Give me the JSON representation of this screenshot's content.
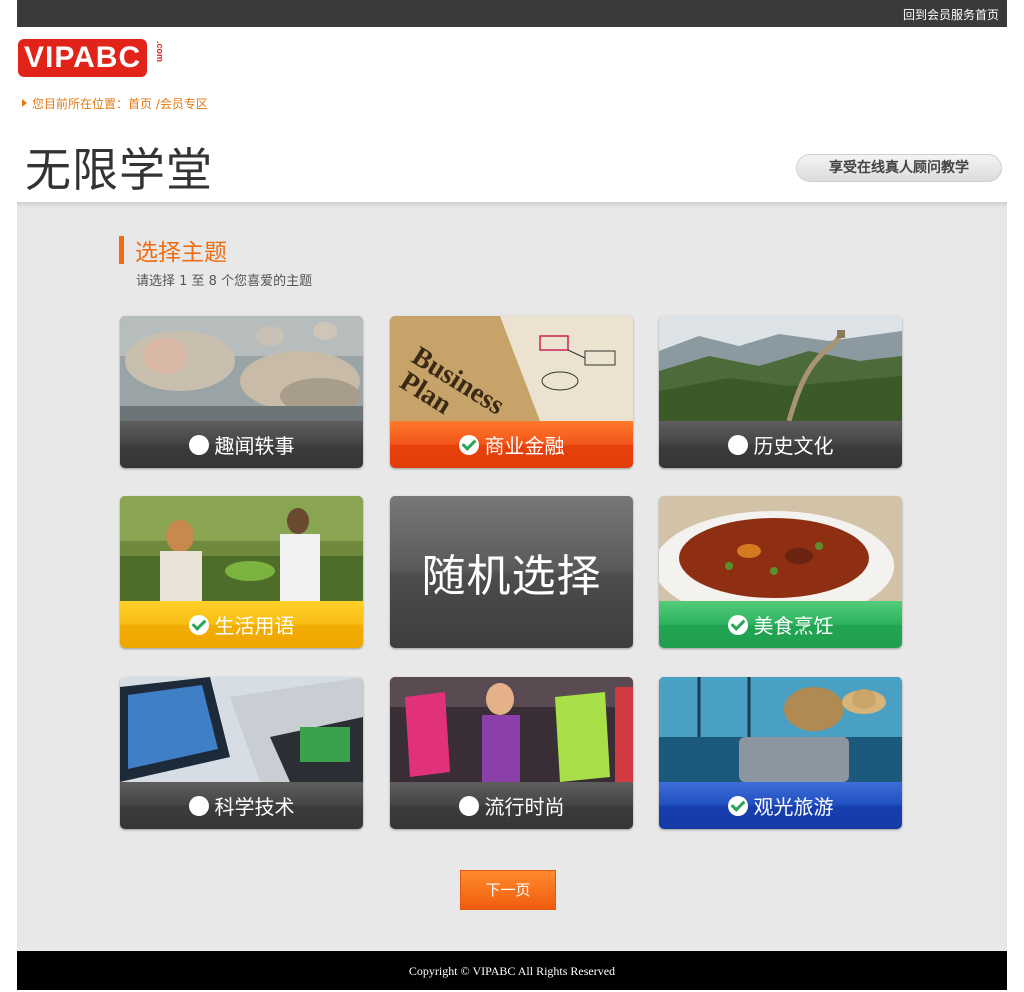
{
  "topbar": {
    "link": "回到会员服务首页"
  },
  "logo": {
    "text": "VIPABC",
    "suffix": ".com"
  },
  "breadcrumb": {
    "text": "您目前所在位置：首页 /会员专区"
  },
  "page": {
    "title": "无限学堂",
    "tagline": "享受在线真人顾问教学"
  },
  "section": {
    "title": "选择主题",
    "subtitle": "请选择 1 至 8 个您喜爱的主题"
  },
  "topics": [
    {
      "label": "趣闻轶事",
      "checked": false,
      "color": "dark"
    },
    {
      "label": "商业金融",
      "checked": true,
      "color": "orange"
    },
    {
      "label": "历史文化",
      "checked": false,
      "color": "dark"
    },
    {
      "label": "生活用语",
      "checked": true,
      "color": "yellow"
    },
    {
      "label": "随机选择"
    },
    {
      "label": "美食烹饪",
      "checked": true,
      "color": "green"
    },
    {
      "label": "科学技术",
      "checked": false,
      "color": "dark"
    },
    {
      "label": "流行时尚",
      "checked": false,
      "color": "dark"
    },
    {
      "label": "观光旅游",
      "checked": true,
      "color": "blue"
    }
  ],
  "next_button": "下一页",
  "footer": "Copyright © VIPABC All Rights Reserved"
}
